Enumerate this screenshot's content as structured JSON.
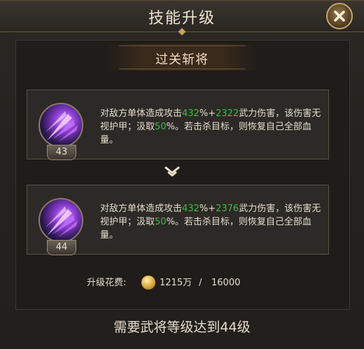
{
  "window": {
    "title": "技能升级",
    "close_icon": "close-icon"
  },
  "section": {
    "title": "过关斩将"
  },
  "cards": [
    {
      "level": "43",
      "desc_parts": [
        "对敌方单体造成攻击",
        "432",
        "%+",
        "2322",
        "武力伤害，该伤害无视护甲；汲取",
        "50",
        "%。若击杀目标，则恢复自己全部血量。"
      ]
    },
    {
      "level": "44",
      "desc_parts": [
        "对敌方单体造成攻击",
        "432",
        "%+",
        "2376",
        "武力伤害，该伤害无视护甲；汲取",
        "50",
        "%。若击杀目标，则恢复自己全部血量。"
      ]
    }
  ],
  "cost": {
    "label": "升级花费:",
    "current": "1215万",
    "separator": "/",
    "total": "16000"
  },
  "requirement": "需要武将等级达到44级",
  "colors": {
    "highlight_green": "#3cbf3c",
    "accent_gold": "#c9a56a"
  }
}
